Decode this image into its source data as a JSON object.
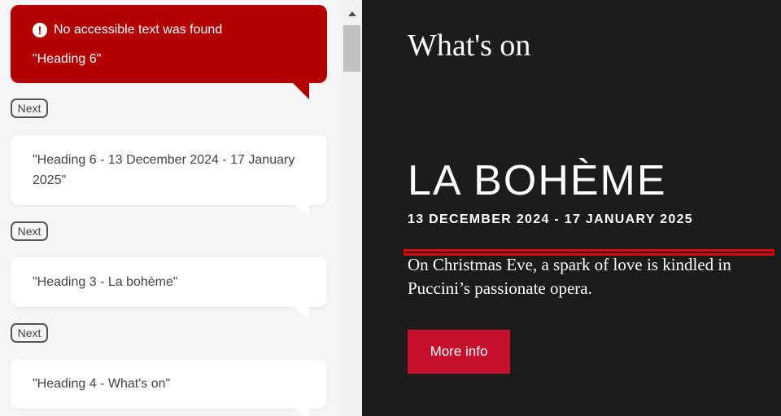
{
  "left_panel": {
    "error": {
      "title": "No accessible text was found",
      "message": "\"Heading 6\"",
      "icon": "alert-circle-icon"
    },
    "next_label": "Next",
    "items": [
      {
        "text": "\"Heading 6 - 13 December 2024 - 17 January 2025\""
      },
      {
        "text": "\"Heading 3 - La bohème\""
      },
      {
        "text": "\"Heading 4 - What's on\""
      }
    ]
  },
  "page": {
    "section_title": "What's on",
    "show_title": "LA BOHÈME",
    "show_dates": "13 DECEMBER 2024 - 17 JANUARY 2025",
    "description": "On Christmas Eve, a spark of love is kindled in Puccini’s passionate opera.",
    "cta_label": "More info"
  },
  "colors": {
    "error_bg": "#b30000",
    "cta_bg": "#c8102e",
    "page_bg": "#1c1c1c",
    "focus_outline": "#e00000"
  }
}
